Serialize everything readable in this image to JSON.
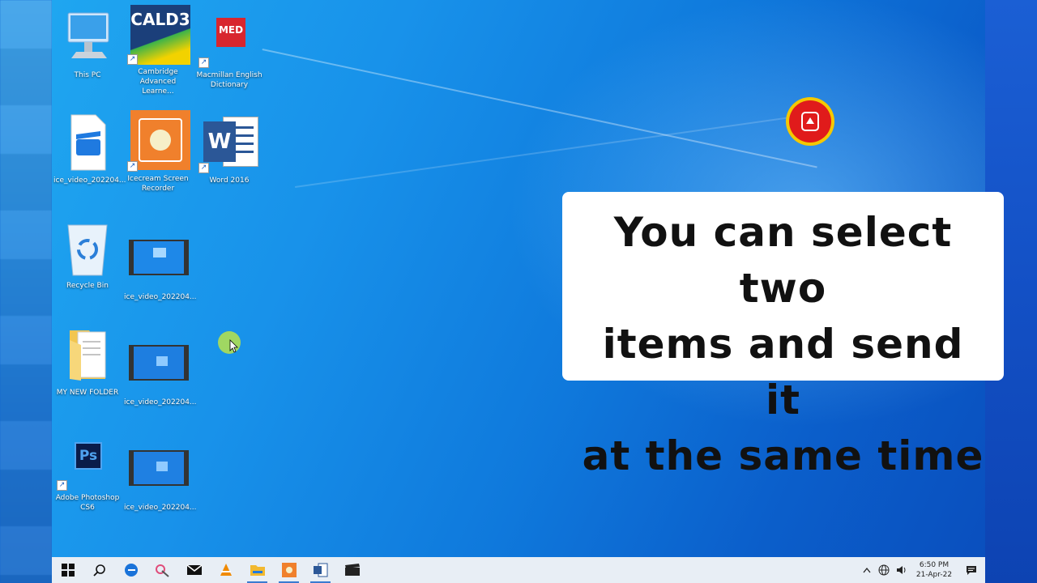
{
  "desktop": {
    "icons": [
      {
        "label": "This PC"
      },
      {
        "label": "Cambridge Advanced Learne...",
        "tile_text": "CALD3"
      },
      {
        "label": "Macmillan English Dictionary",
        "tile_text": "MED"
      },
      {
        "label": "ice_video_202204..."
      },
      {
        "label": "Icecream Screen Recorder"
      },
      {
        "label": "Word 2016",
        "tile_text": "W"
      },
      {
        "label": "Recycle Bin"
      },
      {
        "label": "ice_video_202204..."
      },
      {
        "label": "MY NEW FOLDER"
      },
      {
        "label": "ice_video_202204..."
      },
      {
        "label": "Adobe Photoshop CS6",
        "tile_text": "Ps"
      },
      {
        "label": "ice_video_202204..."
      }
    ]
  },
  "caption": {
    "lines": [
      "You can select two",
      "items and send it",
      "at the same time"
    ]
  },
  "taskbar": {
    "apps": [
      "start-icon",
      "search-icon",
      "edge-icon",
      "snipping-tool-icon",
      "mail-icon",
      "vlc-icon",
      "file-explorer-icon",
      "icecream-recorder-icon",
      "word-icon",
      "video-icon"
    ],
    "clock": {
      "time": "6:50 PM",
      "date": "21-Apr-22"
    }
  },
  "colors": {
    "desktop_accent": "#1892ea",
    "taskbar_bg": "#e8eef5",
    "caption_bg": "#ffffff",
    "badge_red": "#e01b1b",
    "badge_yellow": "#f5c800"
  }
}
